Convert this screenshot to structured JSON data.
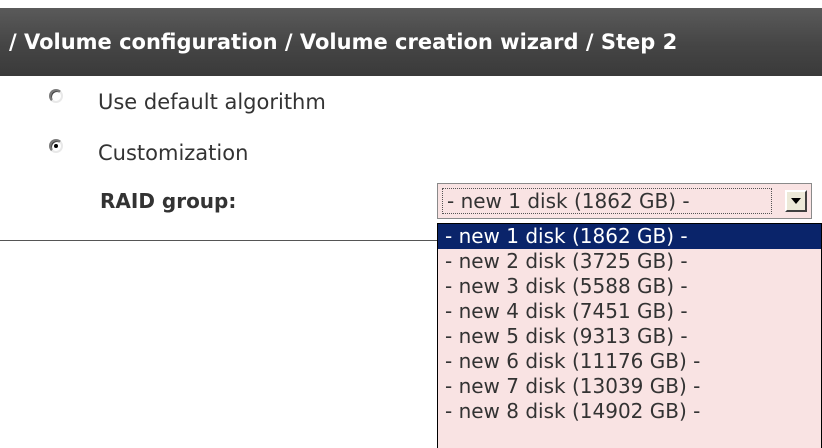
{
  "header": {
    "breadcrumb": "/ Volume configuration / Volume creation wizard / Step 2"
  },
  "options": {
    "default_algorithm": "Use default algorithm",
    "customization": "Customization",
    "selected": "customization"
  },
  "raid_group": {
    "label": "RAID group:",
    "selected_value": "- new 1 disk (1862 GB) -",
    "options": [
      "- new 1 disk (1862 GB) -",
      "- new 2 disk (3725 GB) -",
      "- new 3 disk (5588 GB) -",
      "- new 4 disk (7451 GB) -",
      "- new 5 disk (9313 GB) -",
      "- new 6 disk (11176 GB) -",
      "- new 7 disk (13039 GB) -",
      "- new 8 disk (14902 GB) -"
    ],
    "highlighted_index": 0
  },
  "colors": {
    "header_bg": "#454545",
    "select_bg": "#f9e3e3",
    "highlight_bg": "#0a246a"
  }
}
